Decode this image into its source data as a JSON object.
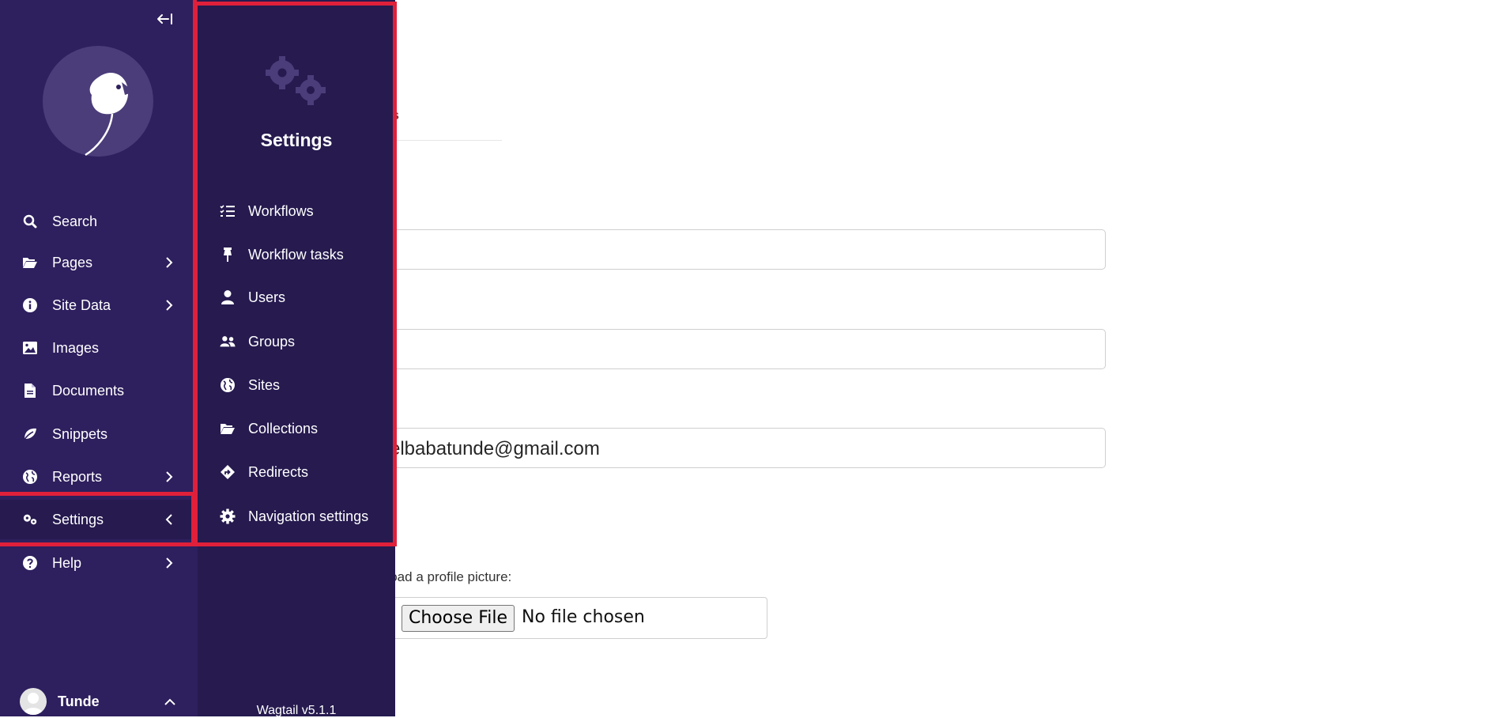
{
  "main": {
    "tab_fragment": "ions",
    "email_value": "elbabatunde@gmail.com",
    "upload_label": "pload a profile picture:",
    "choose_file_label": "Choose File",
    "no_file_text": "No file chosen"
  },
  "sidebar": {
    "collapse_icon": "arrow-left-bar-icon",
    "items": [
      {
        "label": "Search",
        "icon": "search-icon"
      },
      {
        "label": "Pages",
        "icon": "folder-open-icon",
        "chevron": "right"
      },
      {
        "label": "Site Data",
        "icon": "info-circle-icon",
        "chevron": "right"
      },
      {
        "label": "Images",
        "icon": "image-icon"
      },
      {
        "label": "Documents",
        "icon": "doc-icon"
      },
      {
        "label": "Snippets",
        "icon": "snippet-icon"
      },
      {
        "label": "Reports",
        "icon": "globe-icon",
        "chevron": "right"
      },
      {
        "label": "Settings",
        "icon": "cogs-icon",
        "chevron": "left",
        "active": true
      },
      {
        "label": "Help",
        "icon": "help-icon",
        "chevron": "right"
      }
    ],
    "account_name": "Tunde"
  },
  "flyout": {
    "title": "Settings",
    "items": [
      {
        "label": "Workflows",
        "icon": "list-check-icon"
      },
      {
        "label": "Workflow tasks",
        "icon": "pin-icon"
      },
      {
        "label": "Users",
        "icon": "user-icon"
      },
      {
        "label": "Groups",
        "icon": "group-icon"
      },
      {
        "label": "Sites",
        "icon": "globe-icon"
      },
      {
        "label": "Collections",
        "icon": "folder-open-icon"
      },
      {
        "label": "Redirects",
        "icon": "redirect-icon"
      },
      {
        "label": "Navigation settings",
        "icon": "cog-icon"
      }
    ],
    "version": "Wagtail v5.1.1"
  },
  "colors": {
    "sidebar_bg": "#2e1f5e",
    "flyout_bg": "#261a4f",
    "highlight": "#e0203a"
  }
}
